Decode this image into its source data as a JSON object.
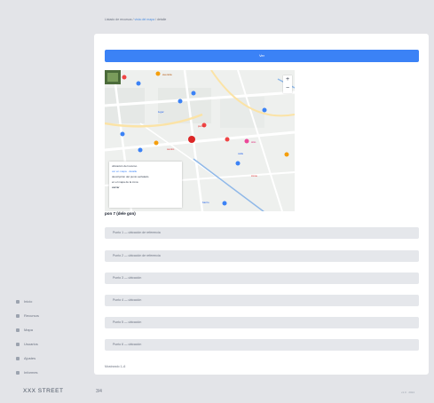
{
  "breadcrumb": {
    "prefix": "Listado de recursos /",
    "link": "vista del mapa",
    "suffix": "/ detalle"
  },
  "primary_button": {
    "label": "Ver"
  },
  "map": {
    "caption": "pon 7 (dele gon)",
    "zoom_in": "+",
    "zoom_out": "−",
    "popup_lines": [
      "ubicación del recurso",
      "ver en mapa · detalle",
      "descripción del punto señalado",
      "en el mapa de la zona",
      "cerrar"
    ]
  },
  "list_items": [
    "Punto 1 — ubicación de referencia",
    "Punto 2 — ubicación de referencia",
    "Punto 3 — ubicación",
    "Punto 4 — ubicación",
    "Punto 5 — ubicación",
    "Punto 6 — ubicación"
  ],
  "bottom_text": "Mostrando 1–6",
  "sidebar": {
    "items": [
      "Inicio",
      "Recursos",
      "Mapa",
      "Usuarios",
      "Ajustes",
      "Informes"
    ]
  },
  "footer": {
    "brand": "XXX STREET",
    "small": "3/4",
    "right": "v1.0 · 2024"
  },
  "colors": {
    "accent": "#3b82f6",
    "background": "#e3e4e8",
    "card": "#ffffff",
    "list_item": "#e5e7eb"
  }
}
